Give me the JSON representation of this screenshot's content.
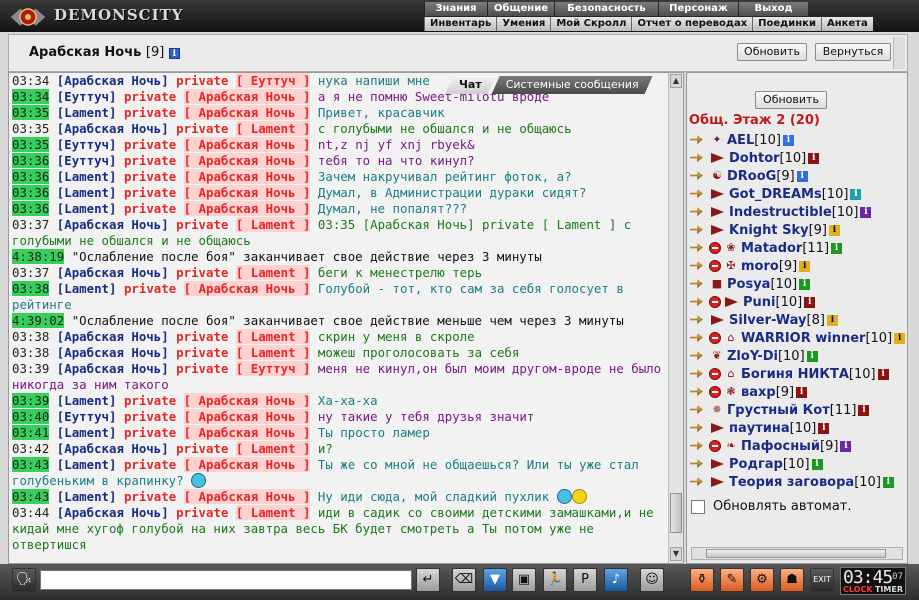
{
  "app": {
    "logo_text": "DEMONSCITY"
  },
  "menu": {
    "row1": [
      "Знания",
      "Общение",
      "Безопасность",
      "Персонаж",
      "Выход"
    ],
    "row2": [
      "Инвентарь",
      "Умения",
      "Мой Скролл",
      "Отчет о переводах",
      "Поединки",
      "Анкета"
    ]
  },
  "header": {
    "room_name": "Арабская Ночь",
    "room_level": "[9]",
    "refresh_label": "Обновить",
    "return_label": "Вернуться"
  },
  "tabs": {
    "chat": "Чат",
    "system": "Системные сообщения"
  },
  "chat": {
    "lines": [
      {
        "time": "03:34",
        "hl": false,
        "from": "[Арабская Ночь]",
        "priv": true,
        "to": "Еуттуч",
        "msg": "нука напиши мне",
        "color": "c-teal"
      },
      {
        "time": "03:34",
        "hl": true,
        "from": "[Еуттуч]",
        "priv": true,
        "to": "Арабская Ночь",
        "msg": "а я не помню Sweet-milotu вроде",
        "color": "c-purple"
      },
      {
        "time": "03:35",
        "hl": true,
        "from": "[Lament]",
        "priv": true,
        "to": "Арабская Ночь",
        "msg": "Привет, красавчик",
        "color": "c-teal"
      },
      {
        "time": "03:35",
        "hl": false,
        "from": "[Арабская Ночь]",
        "priv": true,
        "to": "Lament",
        "msg": "с голубыми не обшался и не общаюсь",
        "color": "c-green"
      },
      {
        "time": "03:35",
        "hl": true,
        "from": "[Еуттуч]",
        "priv": true,
        "to": "Арабская Ночь",
        "msg": "nt,z nj yf xnj rbyek&",
        "color": "c-purple"
      },
      {
        "time": "03:36",
        "hl": true,
        "from": "[Еуттуч]",
        "priv": true,
        "to": "Арабская Ночь",
        "msg": "тебя то на что кинул?",
        "color": "c-purple"
      },
      {
        "time": "03:36",
        "hl": true,
        "from": "[Lament]",
        "priv": true,
        "to": "Арабская Ночь",
        "msg": "Зачем накручивал рейтинг фоток, а?",
        "color": "c-teal"
      },
      {
        "time": "03:36",
        "hl": true,
        "from": "[Lament]",
        "priv": true,
        "to": "Арабская Ночь",
        "msg": "Думал, в Администрации дураки сидят?",
        "color": "c-teal"
      },
      {
        "time": "03:36",
        "hl": true,
        "from": "[Lament]",
        "priv": true,
        "to": "Арабская Ночь",
        "msg": "Думал, не попалят???",
        "color": "c-teal"
      },
      {
        "time": "03:37",
        "hl": false,
        "from": "[Арабская Ночь]",
        "priv": true,
        "to": "Lament",
        "msg": "03:35 [Арабская Ночь] private [ Lament ] с голубыми не обшался и не общаюсь",
        "color": "c-green"
      },
      {
        "time": "4:38:19",
        "hl": true,
        "system": true,
        "msg": "\"Ослабление после боя\" заканчивает свое действие через 3 минуты"
      },
      {
        "time": "03:37",
        "hl": false,
        "from": "[Арабская Ночь]",
        "priv": true,
        "to": "Lament",
        "msg": "беги к менестрелю терь",
        "color": "c-green"
      },
      {
        "time": "03:38",
        "hl": true,
        "from": "[Lament]",
        "priv": true,
        "to": "Арабская Ночь",
        "msg": "Голубой - тот, кто сам за себя голосует в рейтинге",
        "color": "c-teal"
      },
      {
        "time": "4:39:02",
        "hl": true,
        "system": true,
        "msg": "\"Ослабление после боя\" заканчивает свое действие меньше чем через 3 минуты"
      },
      {
        "time": "03:38",
        "hl": false,
        "from": "[Арабская Ночь]",
        "priv": true,
        "to": "Lament",
        "msg": "скрин у меня в скроле",
        "color": "c-green"
      },
      {
        "time": "03:38",
        "hl": false,
        "from": "[Арабская Ночь]",
        "priv": true,
        "to": "Lament",
        "msg": "можеш проголосовать за себя",
        "color": "c-green"
      },
      {
        "time": "03:39",
        "hl": false,
        "from": "[Арабская Ночь]",
        "priv": true,
        "to": "Еуттуч",
        "msg": "меня не кинул,он был моим другом-вроде не было никогда за ним такого",
        "color": "c-purple"
      },
      {
        "time": "03:39",
        "hl": true,
        "from": "[Lament]",
        "priv": true,
        "to": "Арабская Ночь",
        "msg": "Ха-ха-ха",
        "color": "c-teal"
      },
      {
        "time": "03:40",
        "hl": true,
        "from": "[Еуттуч]",
        "priv": true,
        "to": "Арабская Ночь",
        "msg": "ну такие у тебя друзья значит",
        "color": "c-purple"
      },
      {
        "time": "03:41",
        "hl": true,
        "from": "[Lament]",
        "priv": true,
        "to": "Арабская Ночь",
        "msg": "Ты просто ламер",
        "color": "c-teal"
      },
      {
        "time": "03:42",
        "hl": false,
        "from": "[Арабская Ночь]",
        "priv": true,
        "to": "Lament",
        "msg": "и?",
        "color": "c-green"
      },
      {
        "time": "03:43",
        "hl": true,
        "from": "[Lament]",
        "priv": true,
        "to": "Арабская Ночь",
        "msg": "Ты же со мной не общаешься? Или ты уже стал голубеньким в крапинку?",
        "color": "c-teal",
        "smile": "b"
      },
      {
        "time": "03:43",
        "hl": true,
        "from": "[Lament]",
        "priv": true,
        "to": "Арабская Ночь",
        "msg": "Ну иди сюда, мой сладкий пухлик",
        "color": "c-teal",
        "smile": "by"
      },
      {
        "time": "03:44",
        "hl": false,
        "from": "[Арабская Ночь]",
        "priv": true,
        "to": "Lament",
        "msg": "иди в садик со своими детскими замашками,и не кидай мне хугоф голубой на них завтра весь БК будет смотреть а Ты потом уже не отвертишся",
        "color": "c-green"
      }
    ],
    "private_word": "private"
  },
  "right_panel": {
    "refresh_label": "Обновить",
    "floor_title": "Общ. Этаж 2 (20)",
    "users": [
      {
        "name": "AEL",
        "lvl": "[10]",
        "badge": false,
        "clan": "✦",
        "inf": "inf-blue"
      },
      {
        "name": "Dohtor",
        "lvl": "[10]",
        "badge": false,
        "clan": "arrow",
        "inf": "inf-darkred"
      },
      {
        "name": "DRooG",
        "lvl": "[9]",
        "badge": false,
        "clan": "☯",
        "inf": "inf-blue"
      },
      {
        "name": "Got_DREAMs",
        "lvl": "[10]",
        "badge": false,
        "clan": "",
        "inf": "inf-teal"
      },
      {
        "name": "Indestructible",
        "lvl": "[10]",
        "badge": false,
        "clan": "",
        "inf": "inf-purple"
      },
      {
        "name": "Knight Sky",
        "lvl": "[9]",
        "badge": false,
        "clan": "",
        "inf": "inf-yellow"
      },
      {
        "name": "Matador",
        "lvl": "[11]",
        "badge": true,
        "clan": "❀",
        "inf": "inf-green"
      },
      {
        "name": "moro",
        "lvl": "[9]",
        "badge": true,
        "clan": "✠",
        "inf": "inf-yellow"
      },
      {
        "name": "Posya",
        "lvl": "[10]",
        "badge": false,
        "clan": "■",
        "inf": "inf-green"
      },
      {
        "name": "Puni",
        "lvl": "[10]",
        "badge": true,
        "clan": "",
        "inf": "inf-darkred"
      },
      {
        "name": "Silver-Way",
        "lvl": "[8]",
        "badge": false,
        "clan": "",
        "inf": "inf-yellow"
      },
      {
        "name": "WARRIOR winner",
        "lvl": "[10]",
        "badge": true,
        "clan": "⌂",
        "inf": "inf-yellow"
      },
      {
        "name": "ZloY-Di",
        "lvl": "[10]",
        "badge": false,
        "clan": "❦",
        "inf": "inf-green"
      },
      {
        "name": "Богиня НИКТА",
        "lvl": "[10]",
        "badge": true,
        "clan": "⌂",
        "inf": "inf-darkred"
      },
      {
        "name": "вахр",
        "lvl": "[9]",
        "badge": true,
        "clan": "❃",
        "inf": "inf-darkred"
      },
      {
        "name": "Грустный Кот",
        "lvl": "[11]",
        "badge": false,
        "clan": "✵",
        "inf": "inf-darkred"
      },
      {
        "name": "паутина",
        "lvl": "[10]",
        "badge": false,
        "clan": "",
        "inf": "inf-darkred"
      },
      {
        "name": "Пафосный",
        "lvl": "[9]",
        "badge": true,
        "clan": "❧",
        "inf": "inf-purple"
      },
      {
        "name": "Родгар",
        "lvl": "[10]",
        "badge": false,
        "clan": "",
        "inf": "inf-green"
      },
      {
        "name": "Теория заговора",
        "lvl": "[10]",
        "badge": false,
        "clan": "",
        "inf": "inf-green"
      }
    ],
    "auto_refresh_label": "Обновлять автомат."
  },
  "bottom": {
    "input_value": "",
    "clock_time": "03:45",
    "clock_seconds": "07",
    "clock_label": "CLOCK",
    "timer_label": "TIMER"
  }
}
